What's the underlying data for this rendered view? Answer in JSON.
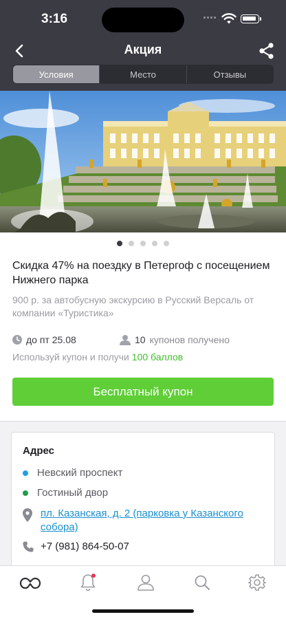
{
  "status_bar": {
    "time": "3:16"
  },
  "header": {
    "title": "Акция",
    "tabs": [
      {
        "label": "Условия",
        "active": true
      },
      {
        "label": "Место",
        "active": false
      },
      {
        "label": "Отзывы",
        "active": false
      }
    ]
  },
  "gallery": {
    "count": 5,
    "active_index": 0
  },
  "offer": {
    "title": "Скидка 47% на поездку в Петергоф с посещением Нижнего парка",
    "subtitle": "900 р. за автобусную экскурсию в Русский Версаль от компании «Туристика»",
    "date": "до пт 25.08",
    "coupons_count": "10",
    "coupons_text": "купонов получено",
    "bonus_prefix": "Используй купон и получи",
    "bonus_value": "100 баллов",
    "cta_label": "Бесплатный купон"
  },
  "address": {
    "title": "Адрес",
    "metro": [
      {
        "name": "Невский проспект",
        "color": "#1aa0e0"
      },
      {
        "name": "Гостиный двор",
        "color": "#1f9e4a"
      }
    ],
    "street": "пл. Казанская, д. 2 (парковка у Казанского собора)",
    "phone": "+7 (981) 864-50-07"
  },
  "tabbar": {
    "items": [
      "logo-icon",
      "bell-icon",
      "profile-icon",
      "search-icon",
      "gear-icon"
    ],
    "notification_dot_color": "#e8345a"
  },
  "colors": {
    "header_bg": "#3b3b44",
    "accent_green": "#5fce37",
    "link_blue": "#1a8fd0"
  }
}
